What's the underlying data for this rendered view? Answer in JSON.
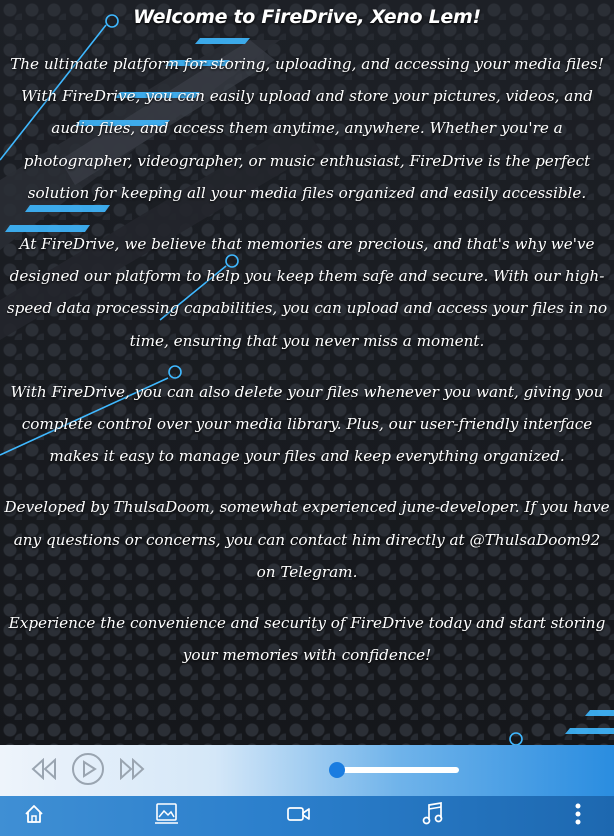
{
  "main": {
    "welcome": "Welcome to FireDrive, Xeno Lem!",
    "paragraphs": [
      "The ultimate platform for storing, uploading, and accessing your media files! With FireDrive, you can easily upload and store your pictures, videos, and audio files, and access them anytime, anywhere. Whether you're a photographer, videographer, or music enthusiast, FireDrive is the perfect solution for keeping all your media files organized and easily accessible.",
      "At FireDrive, we believe that memories are precious, and that's why we've designed our platform to help you keep them safe and secure. With our high-speed data processing capabilities, you can upload and access your files in no time, ensuring that you never miss a moment.",
      "With FireDrive, you can also delete your files whenever you want, giving you complete control over your media library. Plus, our user-friendly interface makes it easy to manage your files and keep everything organized.",
      "Developed by ThulsaDoom, somewhat experienced june-developer. If you have any questions or concerns, you can contact him directly at @ThulsaDoom92 on Telegram.",
      "Experience the convenience and security of FireDrive today and start storing your memories with confidence!"
    ]
  },
  "player": {
    "icons": [
      "rewind-icon",
      "play-icon",
      "fast-forward-icon"
    ],
    "progress": 0.03
  },
  "nav": {
    "icons": [
      "home-icon",
      "image-icon",
      "video-icon",
      "music-icon",
      "more-icon"
    ]
  },
  "colors": {
    "accent": "#1a7ce0",
    "neon": "#3fb8ff",
    "background": "#16181d"
  }
}
